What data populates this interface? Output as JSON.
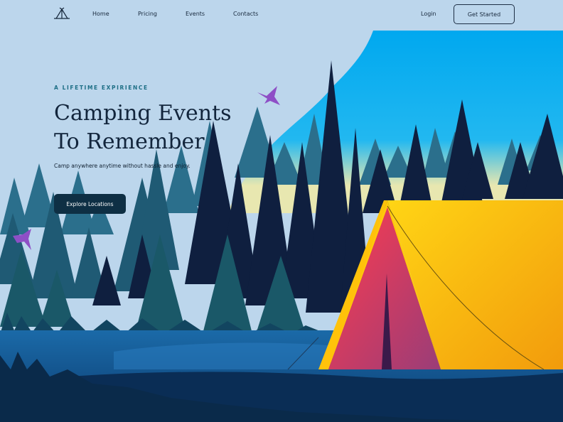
{
  "nav": {
    "logo_icon": "tent-logo-icon",
    "links": [
      "Home",
      "Pricing",
      "Events",
      "Contacts"
    ],
    "login_label": "Login",
    "cta_label": "Get Started"
  },
  "hero": {
    "eyebrow": "A LIFETIME EXPIRIENCE",
    "headline_line1": "Camping Events",
    "headline_line2": "To Remember",
    "subtext": "Camp anywhere anytime without hassle and enjoy.",
    "cta_label": "Explore Locations"
  },
  "colors": {
    "background": "#bcd6ec",
    "sky_accent": "#00aeef",
    "tent_yellow": "#f7c20f",
    "tent_red": "#ec3d55",
    "dark_navy": "#0e2f44",
    "bird": "#8e4fc6"
  },
  "illustration": {
    "icons": [
      "hummingbird-icon",
      "tent-illustration",
      "forest-illustration"
    ]
  }
}
